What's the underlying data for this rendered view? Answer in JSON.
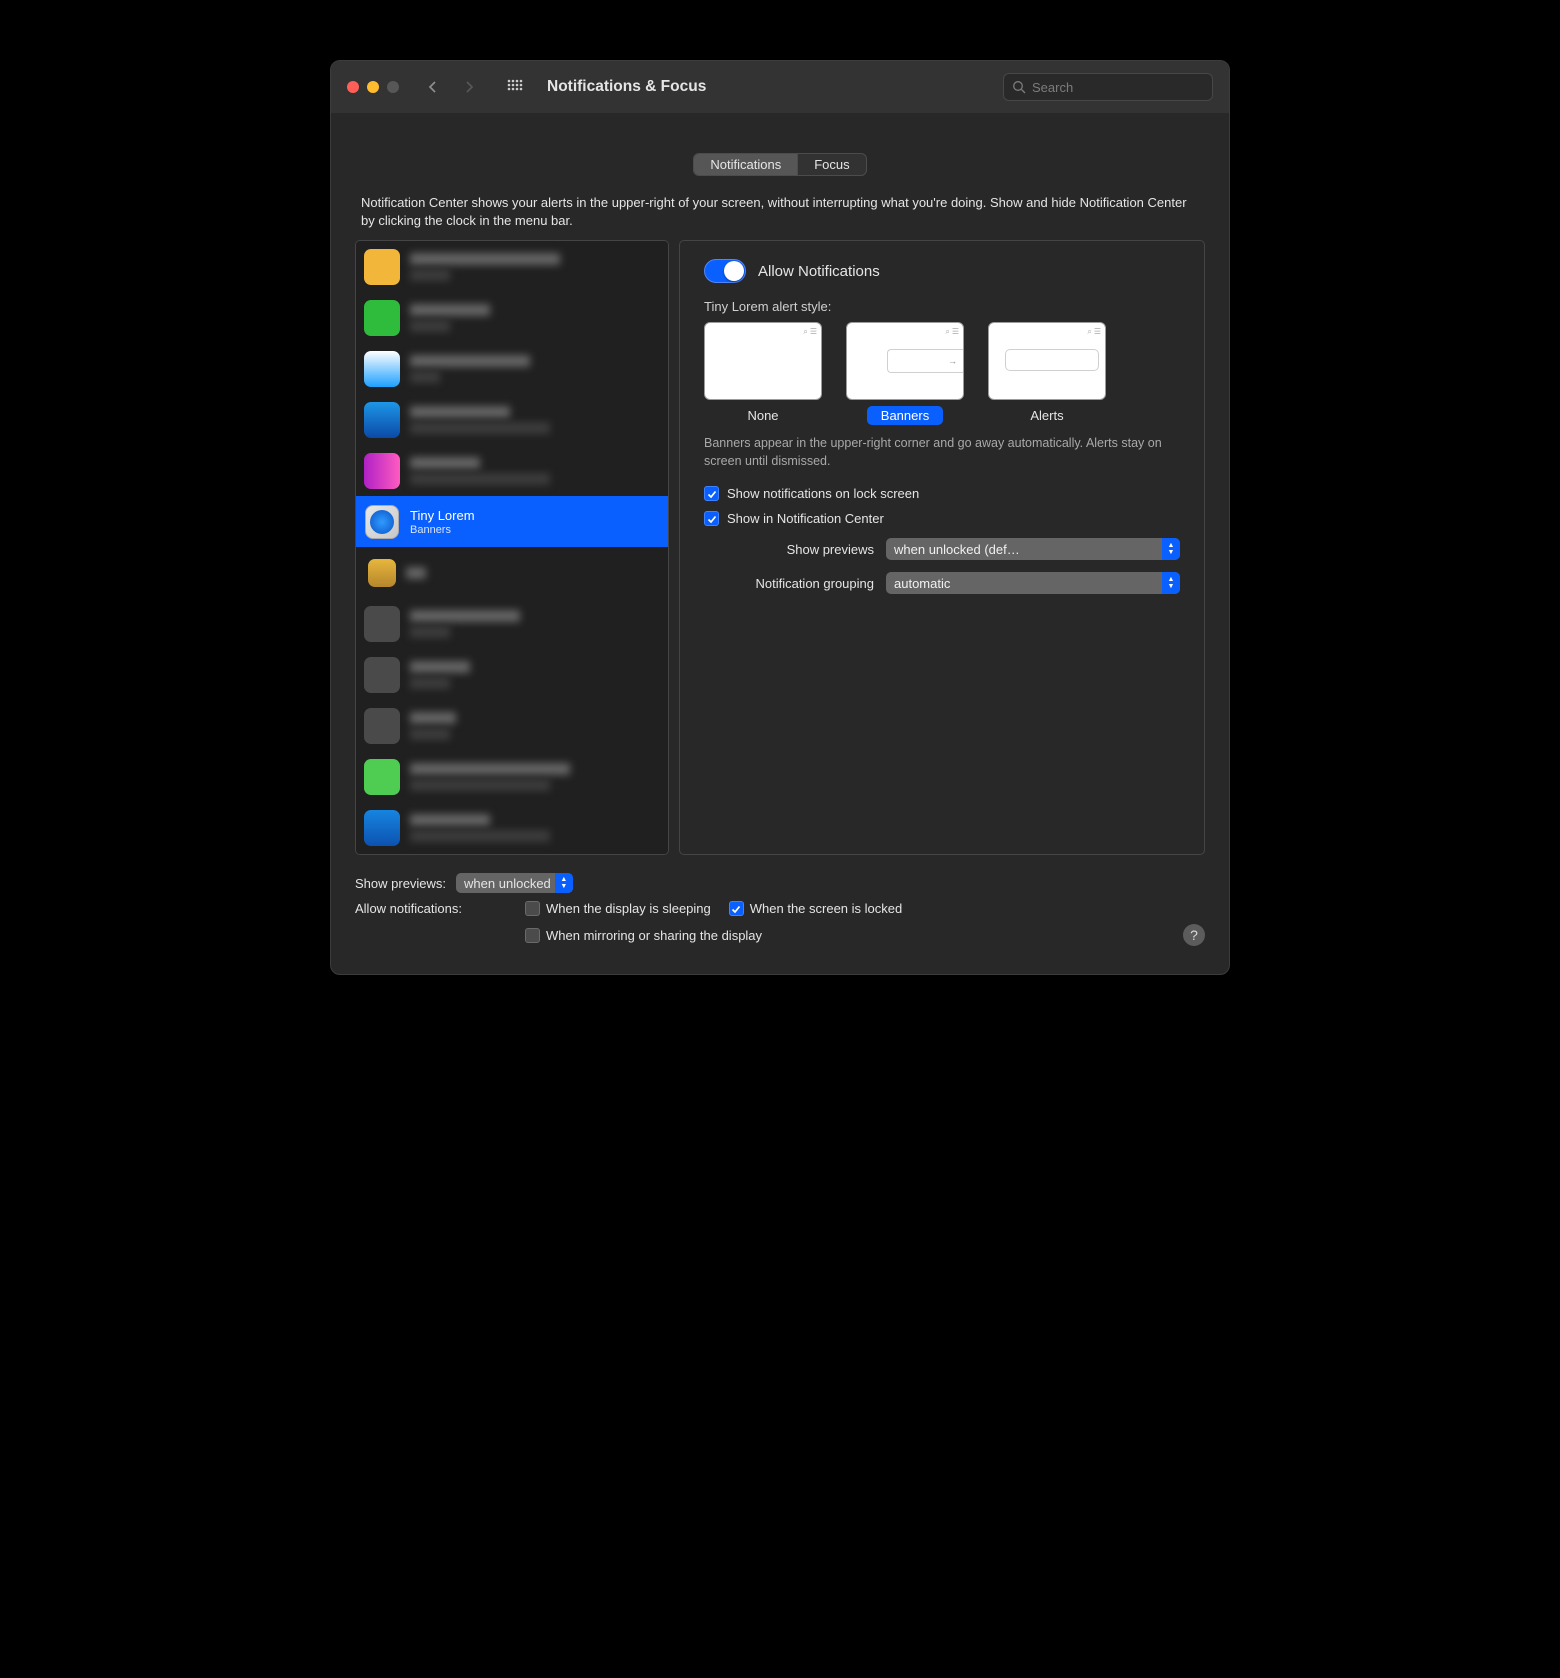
{
  "toolbar": {
    "title": "Notifications & Focus",
    "search_placeholder": "Search"
  },
  "tabs": {
    "notifications": "Notifications",
    "focus": "Focus"
  },
  "intro": "Notification Center shows your alerts in the upper-right of your screen, without interrupting what you're doing. Show and hide Notification Center by clicking the clock in the menu bar.",
  "selected_app": {
    "name": "Tiny Lorem",
    "subtitle": "Banners"
  },
  "detail": {
    "allow": "Allow Notifications",
    "style_label": "Tiny Lorem alert style:",
    "style_none": "None",
    "style_banners": "Banners",
    "style_alerts": "Alerts",
    "style_desc": "Banners appear in the upper-right corner and go away automatically. Alerts stay on screen until dismissed.",
    "chk_lock": "Show notifications on lock screen",
    "chk_center": "Show in Notification Center",
    "previews_lbl": "Show previews",
    "previews_val": "when unlocked (def…",
    "grouping_lbl": "Notification grouping",
    "grouping_val": "automatic"
  },
  "footer": {
    "show_previews_lbl": "Show previews:",
    "show_previews_val": "when unlocked",
    "allow_lbl": "Allow notifications:",
    "opt_sleep": "When the display is sleeping",
    "opt_locked": "When the screen is locked",
    "opt_mirror": "When mirroring or sharing the display"
  },
  "app_row_colors": [
    "#f2b63a",
    "#2fbb3b",
    "#ffffff",
    "#1e96e6",
    "#1764c8",
    "#b021c6",
    "#0a60ff",
    "#d7a22e",
    "#4a4a4a",
    "#4a4a4a",
    "#4a4a4a",
    "#4fcc52",
    "#1685e0",
    "#0d52b0"
  ]
}
